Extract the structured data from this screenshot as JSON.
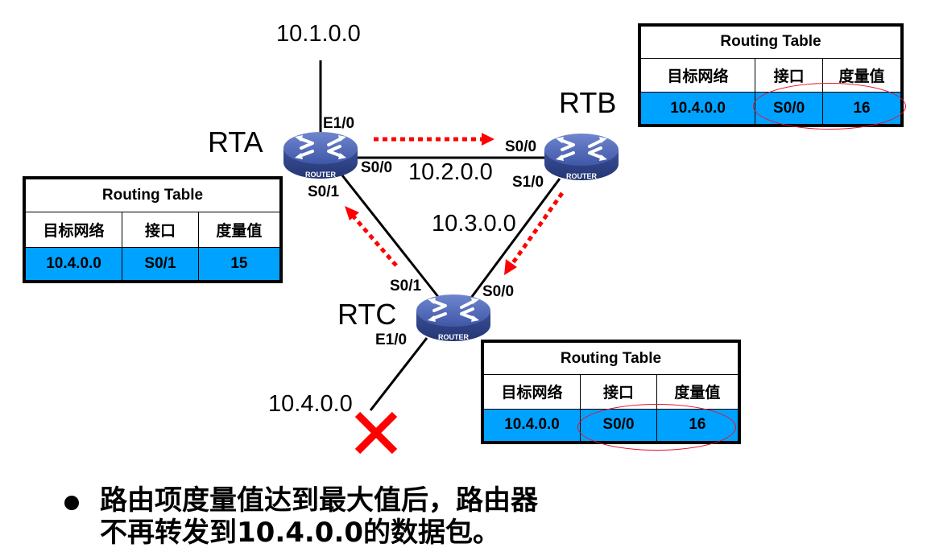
{
  "networks": {
    "n1": "10.1.0.0",
    "n2": "10.2.0.0",
    "n3": "10.3.0.0",
    "n4": "10.4.0.0"
  },
  "routers": {
    "rta": {
      "name": "RTA",
      "badge": "ROUTER"
    },
    "rtb": {
      "name": "RTB",
      "badge": "ROUTER"
    },
    "rtc": {
      "name": "RTC",
      "badge": "ROUTER"
    }
  },
  "interfaces": {
    "rta_e10": "E1/0",
    "rta_s00": "S0/0",
    "rta_s01": "S0/1",
    "rtb_s00": "S0/0",
    "rtb_s10": "S1/0",
    "rtc_s01": "S0/1",
    "rtc_s00": "S0/0",
    "rtc_e10": "E1/0"
  },
  "tables": {
    "rta": {
      "title": "Routing Table",
      "headers": [
        "目标网络",
        "接口",
        "度量值"
      ],
      "row": [
        "10.4.0.0",
        "S0/1",
        "15"
      ]
    },
    "rtb": {
      "title": "Routing Table",
      "headers": [
        "目标网络",
        "接口",
        "度量值"
      ],
      "row": [
        "10.4.0.0",
        "S0/0",
        "16"
      ]
    },
    "rtc": {
      "title": "Routing Table",
      "headers": [
        "目标网络",
        "接口",
        "度量值"
      ],
      "row": [
        "10.4.0.0",
        "S0/0",
        "16"
      ]
    }
  },
  "colors": {
    "router_blue": "#4a63b0",
    "table_highlight": "#00a2ff",
    "update_arrow": "#ff0000",
    "failure_mark": "#ff0000"
  },
  "bullet": {
    "line1": "路由项度量值达到最大值后，路由器",
    "line2": "不再转发到10.4.0.0的数据包。"
  }
}
